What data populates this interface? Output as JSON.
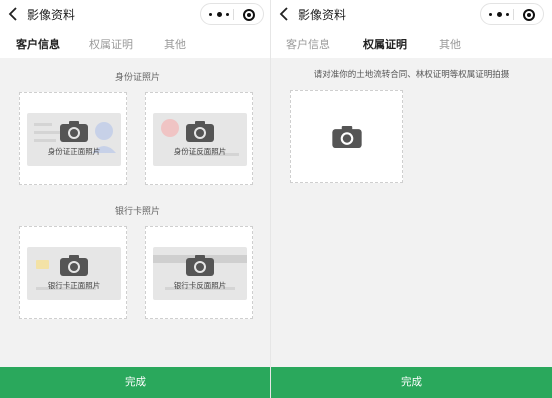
{
  "left_screen": {
    "nav": {
      "title": "影像资料"
    },
    "tabs": [
      {
        "label": "客户信息",
        "active": true
      },
      {
        "label": "权属证明",
        "active": false
      },
      {
        "label": "其他",
        "active": false
      }
    ],
    "id_section": {
      "title": "身份证照片",
      "cards": [
        {
          "label": "身份证正面照片",
          "icon": "camera-icon"
        },
        {
          "label": "身份证反面照片",
          "icon": "camera-icon"
        }
      ]
    },
    "bank_section": {
      "title": "银行卡照片",
      "cards": [
        {
          "label": "银行卡正面照片",
          "icon": "camera-icon"
        },
        {
          "label": "银行卡反面照片",
          "icon": "camera-icon"
        }
      ]
    },
    "done_button": "完成"
  },
  "right_screen": {
    "nav": {
      "title": "影像资料"
    },
    "tabs": [
      {
        "label": "客户信息",
        "active": false
      },
      {
        "label": "权属证明",
        "active": true
      },
      {
        "label": "其他",
        "active": false
      }
    ],
    "hint": "请对准你的土地流转合同、林权证明等权属证明拍摄",
    "done_button": "完成"
  },
  "colors": {
    "primary_green": "#2aa85c",
    "page_bg": "#f2f2f2",
    "placeholder_gray": "#e6e6e6",
    "active_tab": "#222222",
    "inactive_tab": "#9a9a9a"
  }
}
